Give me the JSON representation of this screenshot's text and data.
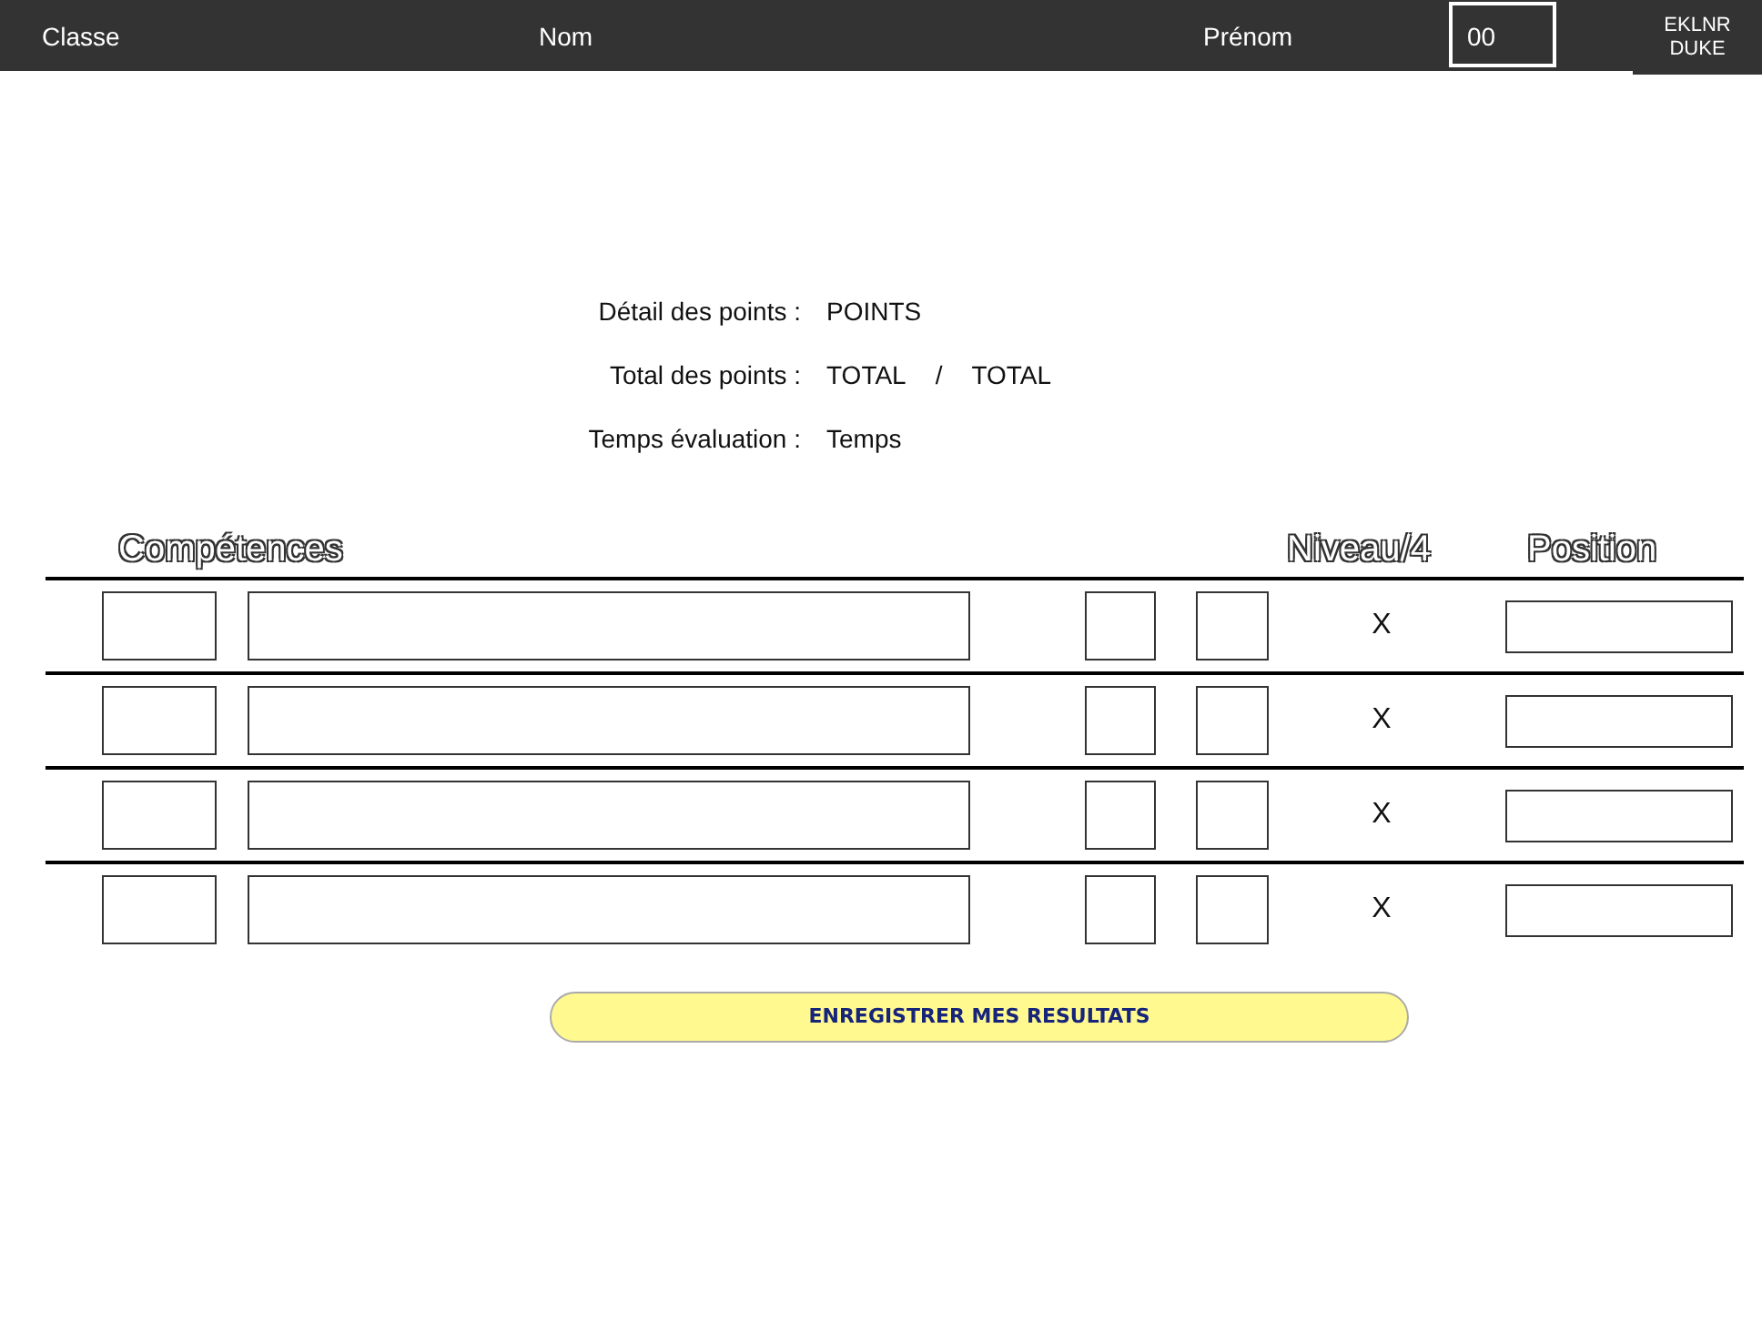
{
  "header": {
    "fields": [
      "Classe",
      "Nom",
      "Prénom"
    ],
    "number": "00",
    "code_lines": [
      "EKLNR",
      "DUKE"
    ]
  },
  "summary": [
    {
      "label": "Détail des points :",
      "values": [
        "POINTS"
      ]
    },
    {
      "label": "Total des points :",
      "values": [
        "TOTAL",
        "/",
        "TOTAL"
      ]
    },
    {
      "label": "Temps évaluation :",
      "values": [
        "Temps"
      ]
    }
  ],
  "table": {
    "columns": [
      "Compétences",
      "Niveau/4",
      "Position"
    ],
    "rows": [
      {
        "level": "X"
      },
      {
        "level": "X"
      },
      {
        "level": "X"
      },
      {
        "level": "X"
      }
    ]
  },
  "button": "ENREGISTRER MES RESULTATS"
}
